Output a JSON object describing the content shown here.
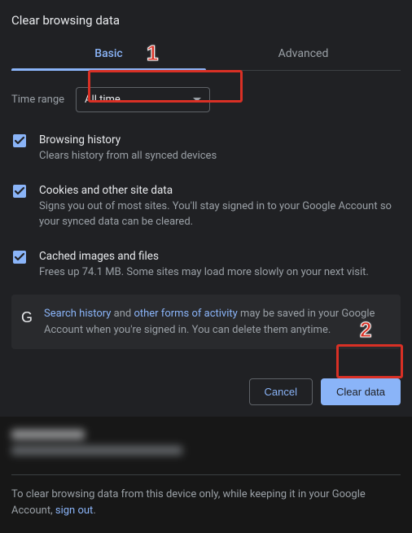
{
  "title": "Clear browsing data",
  "tabs": {
    "basic": "Basic",
    "advanced": "Advanced"
  },
  "time": {
    "label": "Time range",
    "value": "All time"
  },
  "options": [
    {
      "title": "Browsing history",
      "desc": "Clears history from all synced devices"
    },
    {
      "title": "Cookies and other site data",
      "desc": "Signs you out of most sites. You'll stay signed in to your Google Account so your synced data can be cleared."
    },
    {
      "title": "Cached images and files",
      "desc": "Frees up 74.1 MB. Some sites may load more slowly on your next visit."
    }
  ],
  "info": {
    "link1": "Search history",
    "mid1": " and ",
    "link2": "other forms of activity",
    "rest": " may be saved in your Google Account when you're signed in. You can delete them anytime."
  },
  "buttons": {
    "cancel": "Cancel",
    "clear": "Clear data"
  },
  "footer": {
    "text": "To clear browsing data from this device only, while keeping it in your Google Account, ",
    "link": "sign out",
    "tail": "."
  },
  "annotations": {
    "n1": "1",
    "n2": "2"
  }
}
